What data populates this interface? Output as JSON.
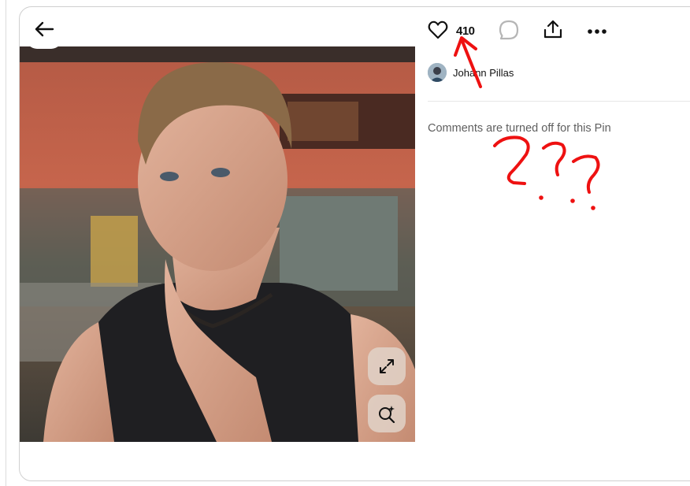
{
  "pin": {
    "like_count": "410",
    "author_name": "Johann Pillas",
    "comments_status": "Comments are turned off for this Pin"
  },
  "icons": {
    "back": "arrow-left-icon",
    "like": "heart-icon",
    "comment": "comment-bubble-icon",
    "share": "share-upload-icon",
    "more": "more-dots-icon",
    "expand": "expand-icon",
    "visual_search": "visual-search-icon"
  },
  "annotation": {
    "marks": "???",
    "color": "#ee1111"
  },
  "colors": {
    "text_primary": "#111111",
    "text_secondary": "#5f5f5f",
    "image_button_bg": "#e1d2c8"
  }
}
